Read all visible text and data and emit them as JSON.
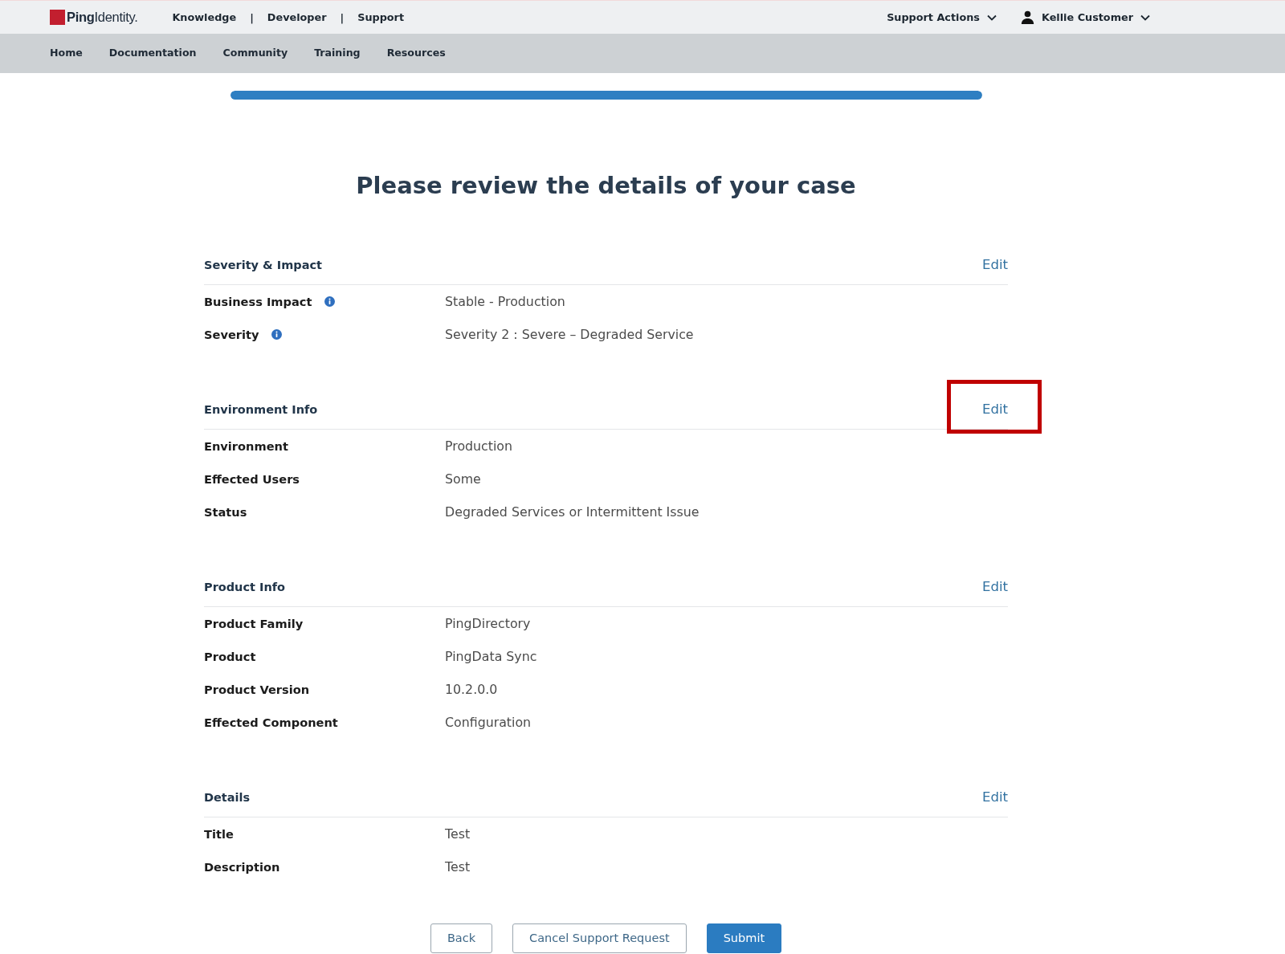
{
  "header": {
    "logo": "**Ping**Identity.",
    "top_links": [
      {
        "kind": "link",
        "label": "Knowledge"
      },
      {
        "kind": "separator",
        "label": "|"
      },
      {
        "kind": "link",
        "label": "Developer"
      },
      {
        "kind": "separator",
        "label": "|"
      },
      {
        "kind": "link",
        "label": "Support"
      }
    ],
    "support_menu": {
      "label": "Support Actions"
    },
    "user_menu": {
      "name": "Kellie Customer"
    }
  },
  "main_nav": [
    {
      "label": "Home"
    },
    {
      "label": "Documentation"
    },
    {
      "label": "Community"
    },
    {
      "label": "Training"
    },
    {
      "label": "Resources"
    }
  ],
  "progress": {
    "level": 1
  },
  "title": "Please review the details of your case",
  "sections": [
    {
      "heading": "Severity & Impact",
      "edit_label": "Edit",
      "edit_highlighted": false,
      "fields": [
        {
          "label": "Business Impact",
          "info": true,
          "value": "Stable - Production"
        },
        {
          "label": "Severity",
          "info": true,
          "value": "Severity 2 : Severe – Degraded Service"
        }
      ]
    },
    {
      "heading": "Environment Info",
      "edit_label": "Edit",
      "edit_highlighted": true,
      "fields": [
        {
          "label": "Environment",
          "info": false,
          "value": "Production"
        },
        {
          "label": "Effected Users",
          "info": false,
          "value": "Some"
        },
        {
          "label": "Status",
          "info": false,
          "value": "Degraded Services or Intermittent Issue"
        }
      ]
    },
    {
      "heading": "Product Info",
      "edit_label": "Edit",
      "edit_highlighted": false,
      "fields": [
        {
          "label": "Product Family",
          "info": false,
          "value": "PingDirectory"
        },
        {
          "label": "Product",
          "info": false,
          "value": "PingData Sync"
        },
        {
          "label": "Product Version",
          "info": false,
          "value": "10.2.0.0"
        },
        {
          "label": "Effected Component",
          "info": false,
          "value": "Configuration"
        }
      ]
    },
    {
      "heading": "Details",
      "edit_label": "Edit",
      "edit_highlighted": false,
      "fields": [
        {
          "label": "Title",
          "info": false,
          "value": "Test"
        },
        {
          "label": "Description",
          "info": false,
          "value": "Test"
        }
      ]
    }
  ],
  "buttons": [
    {
      "kind": "outline",
      "label": "Back"
    },
    {
      "kind": "outline",
      "label": "Cancel Support Request"
    },
    {
      "kind": "primary",
      "label": "Submit"
    }
  ]
}
